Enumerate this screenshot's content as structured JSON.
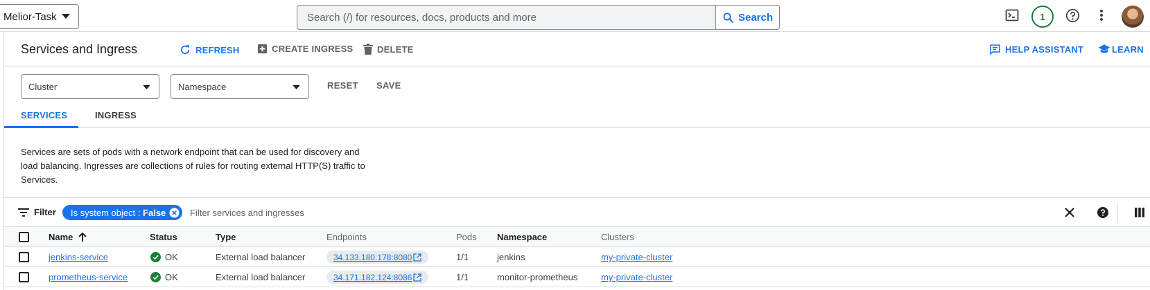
{
  "topbar": {
    "project": "Melior-Task",
    "search_placeholder": "Search (/) for resources, docs, products and more",
    "search_button": "Search",
    "notification_count": "1"
  },
  "header": {
    "title": "Services and Ingress",
    "refresh": "REFRESH",
    "create_ingress": "CREATE INGRESS",
    "delete": "DELETE",
    "help_assistant": "HELP ASSISTANT",
    "learn": "LEARN"
  },
  "filters": {
    "cluster": "Cluster",
    "namespace": "Namespace",
    "reset": "RESET",
    "save": "SAVE"
  },
  "tabs": [
    {
      "label": "SERVICES",
      "active": true
    },
    {
      "label": "INGRESS",
      "active": false
    }
  ],
  "description": "Services are sets of pods with a network endpoint that can be used for discovery and load balancing. Ingresses are collections of rules for routing external HTTP(S) traffic to Services.",
  "table_toolbar": {
    "filter_label": "Filter",
    "chip_key": "Is system object",
    "chip_value": "False",
    "filter_placeholder": "Filter services and ingresses"
  },
  "table": {
    "columns": [
      "Name",
      "Status",
      "Type",
      "Endpoints",
      "Pods",
      "Namespace",
      "Clusters"
    ],
    "rows": [
      {
        "name": "jenkins-service",
        "status": "OK",
        "type": "External load balancer",
        "endpoint": "34.133.180.178:8080",
        "pods": "1/1",
        "namespace": "jenkins",
        "cluster": "my-private-cluster"
      },
      {
        "name": "prometheus-service",
        "status": "OK",
        "type": "External load balancer",
        "endpoint": "34.171.182.124:8086",
        "pods": "1/1",
        "namespace": "monitor-prometheus",
        "cluster": "my-private-cluster"
      }
    ]
  },
  "colors": {
    "accent": "#1a73e8",
    "ok": "#188038",
    "notif": "#188038"
  }
}
